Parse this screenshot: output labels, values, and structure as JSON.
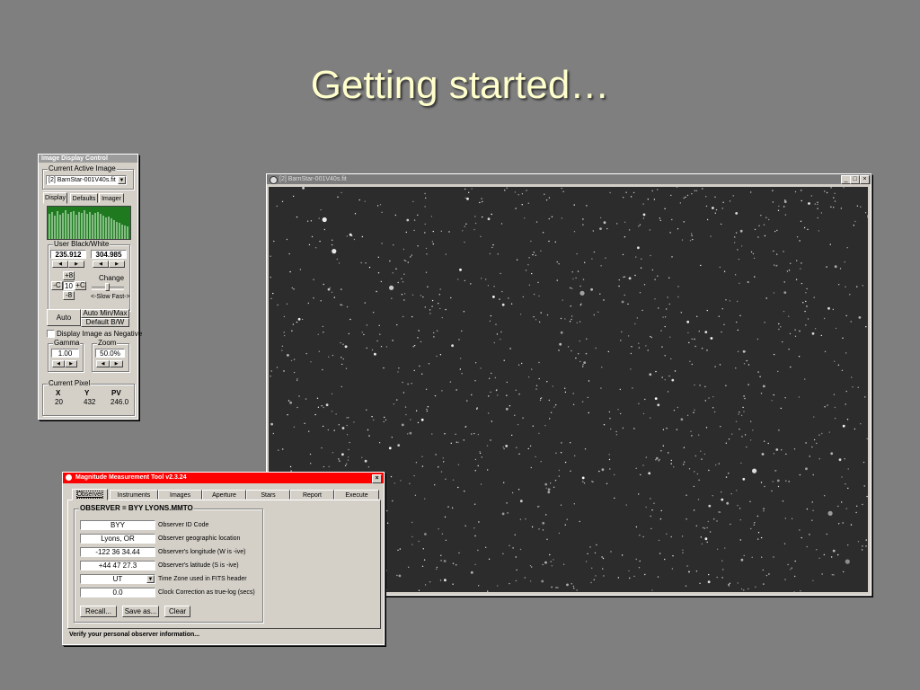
{
  "slide": {
    "title": "Getting started…"
  },
  "image_display_control": {
    "title": "Image Display Control",
    "current_active_image_label": "Current Active Image",
    "current_active_image_value": "[2] BarnStar-001V40s.fit",
    "tabs": [
      "Display",
      "Defaults",
      "Imager"
    ],
    "user_bw_label": "User Black/White",
    "black_value": "235.912",
    "white_value": "304.985",
    "plus8": "+8",
    "minus8": "-8",
    "minusC": "-C",
    "plusC": "+C",
    "ten": "10",
    "change_label": "Change",
    "slow_fast_label": "<-Slow Fast->",
    "auto_label": "Auto",
    "auto_minmax_label": "Auto Min/Max",
    "default_bw_label": "Default B/W",
    "negative_label": "Display Image as Negative",
    "gamma_label": "Gamma",
    "gamma_value": "1.00",
    "zoom_label": "Zoom",
    "zoom_value": "50.0%",
    "current_pixel_label": "Current  Pixel",
    "x_label": "X",
    "y_label": "Y",
    "pv_label": "PV",
    "x_value": "20",
    "y_value": "432",
    "pv_value": "246.0"
  },
  "image_window": {
    "title": "[2] BarnStar-001V40s.fit",
    "minimize": "_",
    "maximize": "□",
    "close": "×"
  },
  "magnitude_tool": {
    "title": "Magnitude Measurement Tool v2.3.24",
    "close": "×",
    "tabs": [
      "Observer",
      "Instruments",
      "Images",
      "Aperture",
      "Stars",
      "Report",
      "Execute"
    ],
    "group_title": "OBSERVER = BYY LYONS.MMTO",
    "fields": [
      {
        "value": "BYY",
        "label": "Observer ID Code"
      },
      {
        "value": "Lyons, OR",
        "label": "Observer geographic location"
      },
      {
        "value": "-122 36 34.44",
        "label": "Observer's longitude (W is -ive)"
      },
      {
        "value": "+44 47 27.3",
        "label": "Observer's latitude (S is -ive)"
      },
      {
        "value": "UT",
        "label": "Time Zone used in FITS header"
      },
      {
        "value": "0.0",
        "label": "Clock Correction as true-log (secs)"
      }
    ],
    "recall_label": "Recall...",
    "save_as_label": "Save as...",
    "clear_label": "Clear",
    "status": "Verify your personal observer information..."
  }
}
